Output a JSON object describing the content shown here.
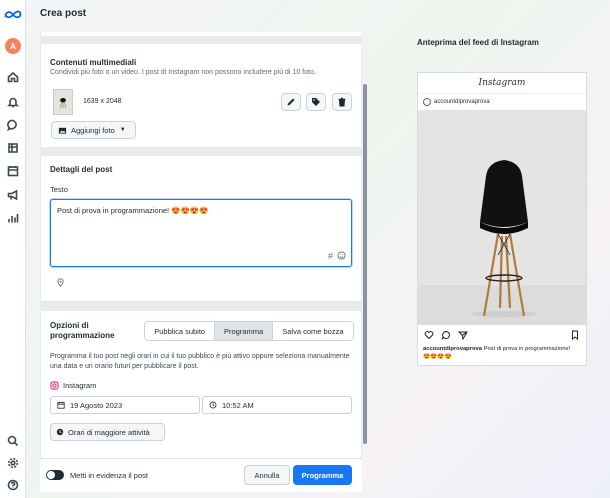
{
  "page": {
    "title": "Crea post"
  },
  "rail": {
    "avatar_letter": "A"
  },
  "media": {
    "title": "Contenuti multimediali",
    "description": "Condividi più foto o un video. I post di Instagram non possono includere più di 10 foto.",
    "image_dimensions": "1639 x 2048",
    "add_photo_label": "Aggiungi foto"
  },
  "details": {
    "title": "Dettagli del post",
    "text_label": "Testo",
    "text_value": "Post di prova in programmazione! 😍😍😍😍"
  },
  "options": {
    "title_line1": "Opzioni di",
    "title_line2": "programmazione",
    "tabs": [
      {
        "label": "Pubblica subito",
        "active": false
      },
      {
        "label": "Programma",
        "active": true
      },
      {
        "label": "Salva come bozza",
        "active": false
      }
    ],
    "description": "Programma il tuo post negli orari in cui il tuo pubblico è più attivo oppure seleziona manualmente una data e un orario futuri per pubblicare il post.",
    "platform": "Instagram",
    "date": "19 Agosto 2023",
    "time": "10:52 AM",
    "best_times_label": "Orari di maggiore attività"
  },
  "footer": {
    "boost_label": "Metti in evidenza il post",
    "cancel_label": "Annulla",
    "schedule_label": "Programma"
  },
  "preview": {
    "title": "Anteprima del feed di Instagram",
    "app_name": "Instagram",
    "account": "accountdiprovaprova",
    "caption_account": "accountdiprovaprova",
    "caption_text": "Post di prova in programmazione!",
    "caption_emojis": "😍😍😍😍"
  },
  "colors": {
    "primary": "#1877f2",
    "avatar": "#f4845f",
    "wall": "#e4e4e2"
  }
}
